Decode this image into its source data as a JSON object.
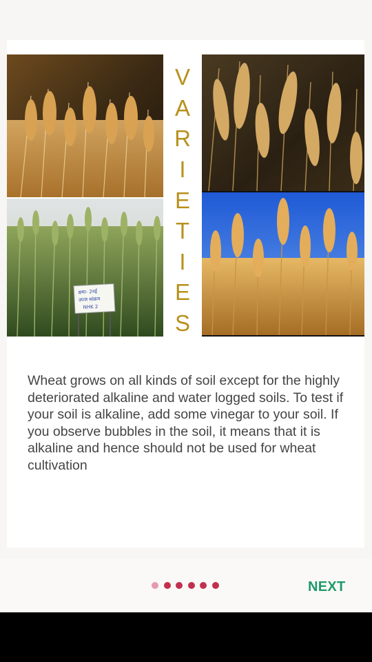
{
  "collage": {
    "vertical_letters": [
      "V",
      "A",
      "R",
      "I",
      "E",
      "T",
      "I",
      "E",
      "S"
    ],
    "sign_text": [
      "क्षमा- 2नई",
      "उपज सांक्रम",
      "NHK 2"
    ],
    "photos": [
      {
        "name": "golden-wheat-closeup"
      },
      {
        "name": "green-wheat-field-with-sign"
      },
      {
        "name": "ripe-wheat-ears-dark-background"
      },
      {
        "name": "golden-wheat-blue-sky"
      }
    ]
  },
  "description": "Wheat grows on all kinds of soil except for the highly deteriorated alkaline and water logged soils. To test if your soil is alkaline, add some vinegar to your soil. If you observe bubbles in the soil, it means that it is alkaline and hence should not be used for wheat cultivation",
  "pagination": {
    "total": 6,
    "current": 1
  },
  "next_button": {
    "label": "NEXT"
  },
  "colors": {
    "accent_gold": "#b7911b",
    "dot_active": "#e79aae",
    "dot_inactive": "#c2304f",
    "next": "#1e9a6a"
  }
}
